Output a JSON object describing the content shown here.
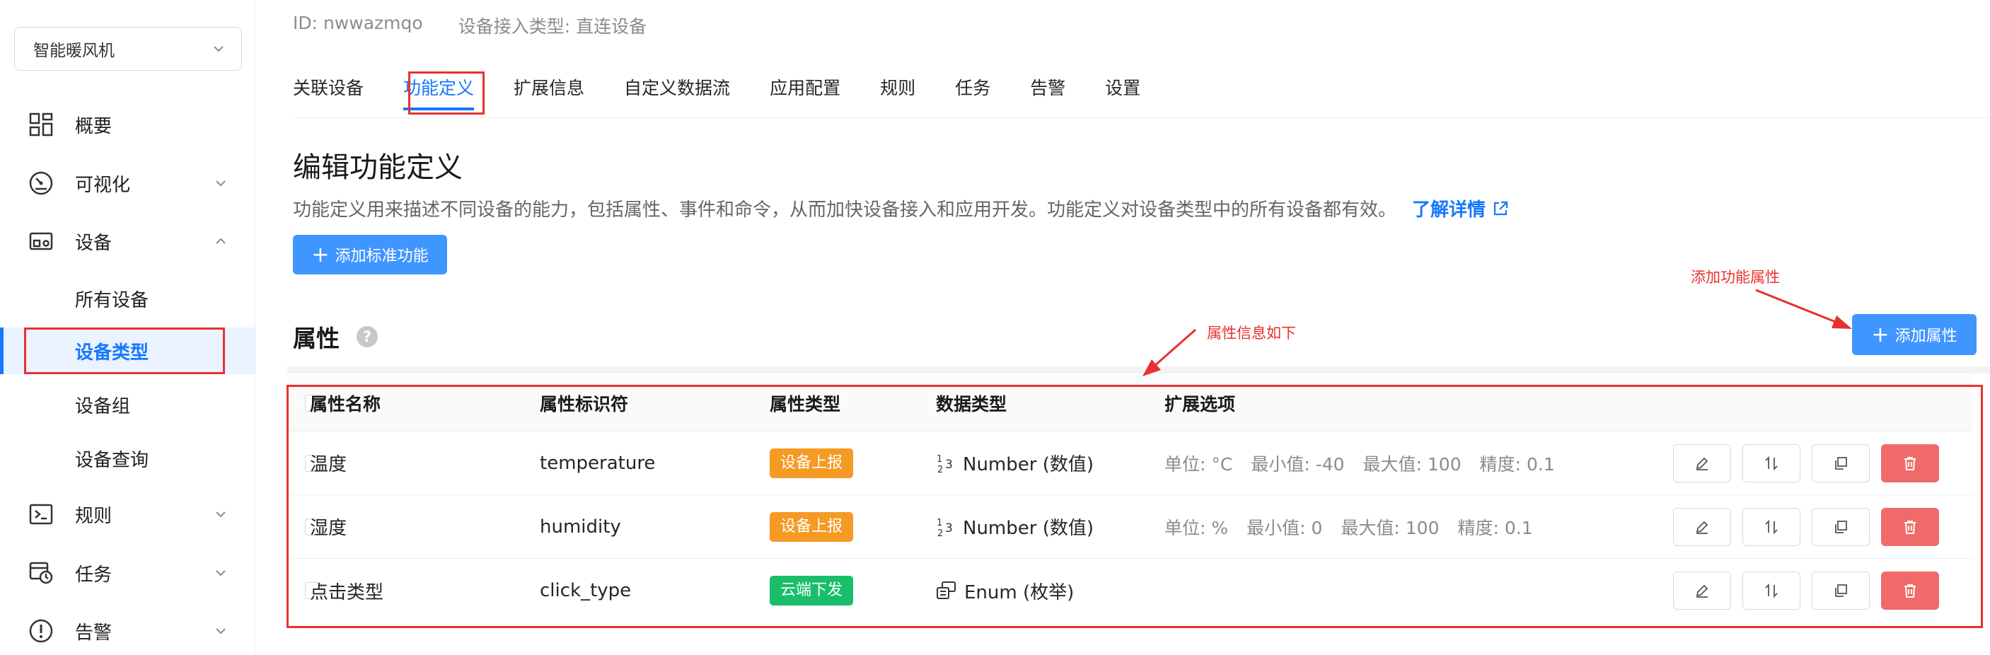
{
  "sidebar": {
    "selector": {
      "value": "智能暖风机"
    },
    "nav": {
      "overview": "概要",
      "visualize": "可视化",
      "devices": "设备",
      "rules": "规则",
      "tasks": "任务",
      "alarms": "告警"
    },
    "sub": {
      "all_devices": "所有设备",
      "device_types": "设备类型",
      "device_groups": "设备组",
      "device_query": "设备查询"
    }
  },
  "header": {
    "id_text": "ID: nwwazmqo",
    "access_type": "设备接入类型: 直连设备"
  },
  "tabs": [
    "关联设备",
    "功能定义",
    "扩展信息",
    "自定义数据流",
    "应用配置",
    "规则",
    "任务",
    "告警",
    "设置"
  ],
  "active_tab": "功能定义",
  "page": {
    "title": "编辑功能定义",
    "description": "功能定义用来描述不同设备的能力，包括属性、事件和命令，从而加快设备接入和应用开发。功能定义对设备类型中的所有设备都有效。",
    "learn_more": "了解详情",
    "add_standard": "添加标准功能",
    "section_title": "属性",
    "help_mark": "?",
    "add_property": "添加属性"
  },
  "table": {
    "headers": [
      "属性名称",
      "属性标识符",
      "属性类型",
      "数据类型",
      "扩展选项"
    ],
    "rows": [
      {
        "name": "温度",
        "identifier": "temperature",
        "type": "设备上报",
        "type_color": "#f59a23",
        "data_type": "Number (数值)",
        "data_icon": "number-icon",
        "ext": [
          "单位: °C",
          "最小值: -40",
          "最大值: 100",
          "精度: 0.1"
        ]
      },
      {
        "name": "湿度",
        "identifier": "humidity",
        "type": "设备上报",
        "type_color": "#f59a23",
        "data_type": "Number (数值)",
        "data_icon": "number-icon",
        "ext": [
          "单位: %",
          "最小值: 0",
          "最大值: 100",
          "精度: 0.1"
        ]
      },
      {
        "name": "点击类型",
        "identifier": "click_type",
        "type": "云端下发",
        "type_color": "#19be6b",
        "data_type": "Enum (枚举)",
        "data_icon": "enum-icon",
        "ext": []
      }
    ]
  },
  "annotations": {
    "add_property_note": "添加功能属性",
    "table_note": "属性信息如下"
  },
  "colors": {
    "accent": "#1677ff",
    "button": "#4096ff",
    "danger": "#f06a6a",
    "annotation": "#e8312f"
  }
}
